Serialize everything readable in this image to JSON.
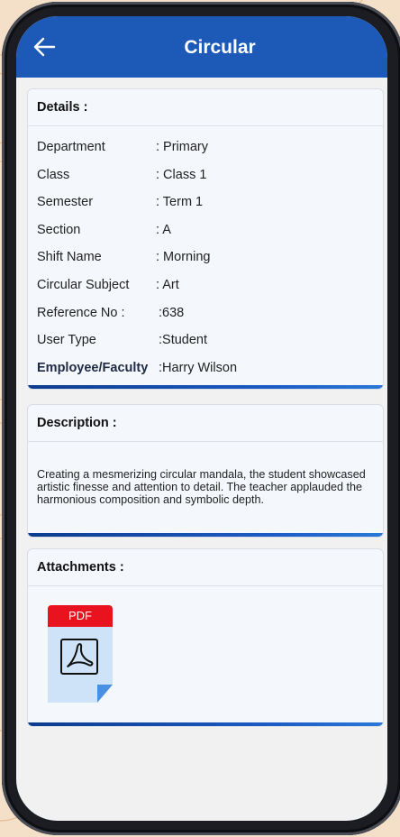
{
  "header": {
    "title": "Circular"
  },
  "details": {
    "heading": "Details :",
    "rows": [
      {
        "label": "Department",
        "value": ": Primary"
      },
      {
        "label": "Class",
        "value": ": Class 1"
      },
      {
        "label": "Semester",
        "value": ": Term 1"
      },
      {
        "label": "Section",
        "value": ": A"
      },
      {
        "label": "Shift Name",
        "value": ": Morning"
      },
      {
        "label": "Circular Subject",
        "value": ": Art"
      },
      {
        "label": "Reference No :",
        "value": ":638"
      },
      {
        "label": "User Type",
        "value": ":Student"
      },
      {
        "label": "Employee/Faculty",
        "value": ":Harry Wilson"
      }
    ]
  },
  "description": {
    "heading": "Description :",
    "text": "Creating a mesmerizing circular mandala, the student showcased artistic finesse and attention to detail. The teacher applauded the harmonious composition and symbolic depth."
  },
  "attachments": {
    "heading": "Attachments :",
    "file_badge": "PDF",
    "icon": "pdf-file-icon"
  },
  "colors": {
    "appbar": "#1d5ab8",
    "accent_bar": "#0d3c8e",
    "pdf_badge": "#e8131f"
  }
}
